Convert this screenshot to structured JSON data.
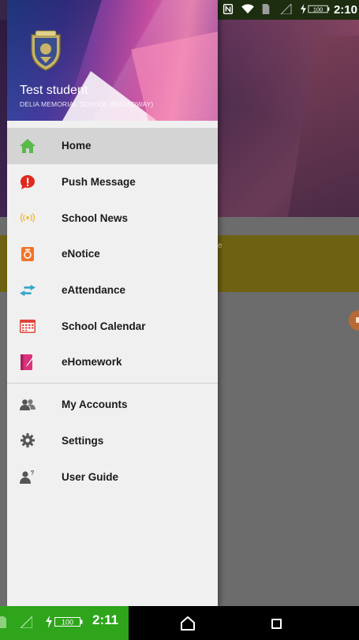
{
  "status_bar": {
    "time": "2:10",
    "battery": "100"
  },
  "drawer": {
    "student_name": "Test student",
    "school_name": "DELIA MEMORIAL SCHOOL (BROADWAY)",
    "menu_items": [
      {
        "label": "Home",
        "icon": "home-icon",
        "color": "#5bb84a"
      },
      {
        "label": "Push Message",
        "icon": "push-message-icon",
        "color": "#e0281c"
      },
      {
        "label": "School News",
        "icon": "broadcast-icon",
        "color": "#f2b632"
      },
      {
        "label": "eNotice",
        "icon": "notice-icon",
        "color": "#f2732a"
      },
      {
        "label": "eAttendance",
        "icon": "attendance-arrows-icon",
        "color": "#3aa6c8"
      },
      {
        "label": "School Calendar",
        "icon": "calendar-icon",
        "color": "#e0453a"
      },
      {
        "label": "eHomework",
        "icon": "homework-icon",
        "color": "#d9327a"
      }
    ],
    "secondary_items": [
      {
        "label": "My Accounts",
        "icon": "accounts-icon"
      },
      {
        "label": "Settings",
        "icon": "gear-icon"
      },
      {
        "label": "User Guide",
        "icon": "user-guide-icon"
      }
    ]
  },
  "nav_bar": {
    "time": "2:11",
    "battery": "100"
  }
}
